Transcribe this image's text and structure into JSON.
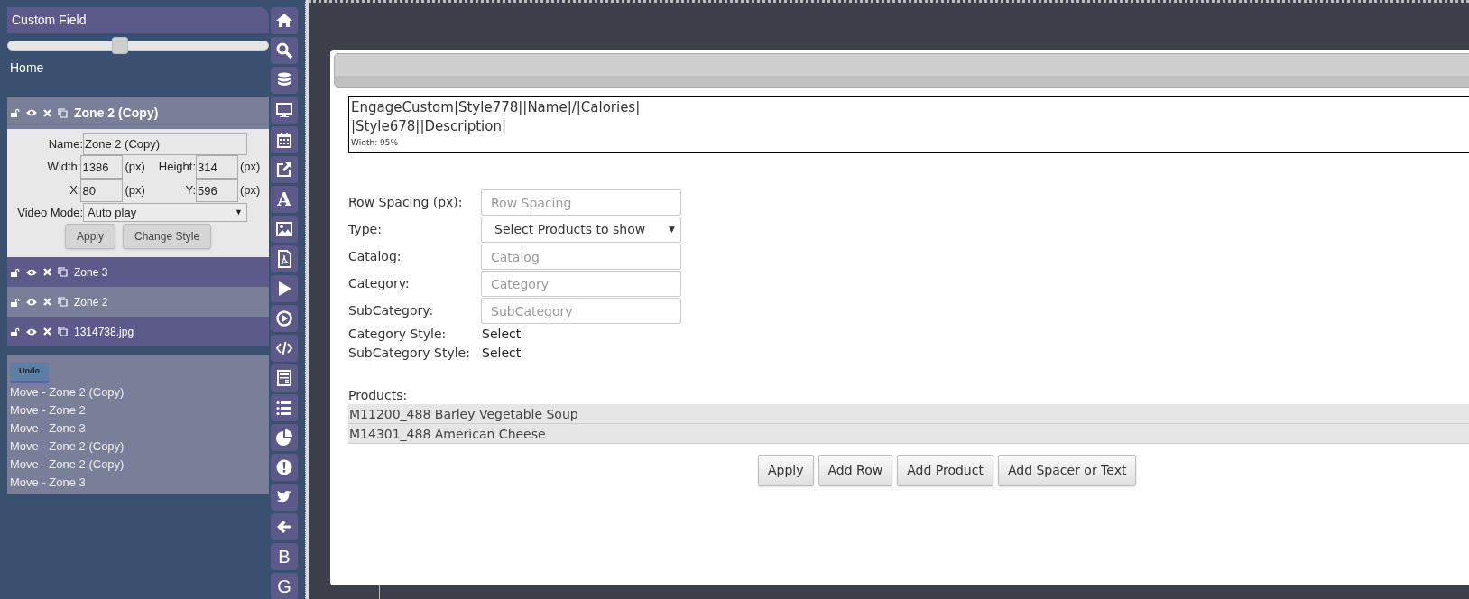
{
  "sidebar": {
    "header": "Custom Field",
    "slider": {
      "level": 0.43
    },
    "breadcrumb": "Home",
    "layers": [
      {
        "name": "Zone 2 (Copy)",
        "expanded": true,
        "highlighted": true
      },
      {
        "name": "Zone 3",
        "expanded": false,
        "highlighted": false
      },
      {
        "name": "Zone 2",
        "expanded": false,
        "highlighted": true
      },
      {
        "name": "1314738.jpg",
        "expanded": false,
        "highlighted": false
      }
    ],
    "zone_form": {
      "name": {
        "label": "Name:",
        "value": "Zone 2 (Copy)"
      },
      "pairs": [
        [
          {
            "label": "Width:",
            "value": "1386",
            "unit": "(px)"
          },
          {
            "label": "Height:",
            "value": "314",
            "unit": "(px)"
          }
        ],
        [
          {
            "label": "X:",
            "value": "80",
            "unit": "(px)"
          },
          {
            "label": "Y:",
            "value": "596",
            "unit": "(px)"
          }
        ]
      ],
      "video_mode": {
        "label": "Video Mode:",
        "value": "Auto play",
        "caret": "▼"
      },
      "buttons": [
        "Apply",
        "Change Style"
      ]
    },
    "history": {
      "undo_button": "Undo",
      "entries": [
        "Move - Zone 2 (Copy)",
        "Move - Zone 2",
        "Move - Zone 3",
        "Move - Zone 2 (Copy)",
        "Move - Zone 2 (Copy)",
        "Move - Zone 3"
      ]
    }
  },
  "toolbar": [
    {
      "kind": "icon"
    },
    {
      "kind": "icon"
    },
    {
      "kind": "icon"
    },
    {
      "kind": "icon"
    },
    {
      "kind": "icon"
    },
    {
      "kind": "icon"
    },
    {
      "kind": "letter",
      "text": "A"
    },
    {
      "kind": "icon"
    },
    {
      "kind": "icon"
    },
    {
      "kind": "icon"
    },
    {
      "kind": "icon"
    },
    {
      "kind": "icon"
    },
    {
      "kind": "icon"
    },
    {
      "kind": "icon"
    },
    {
      "kind": "icon"
    },
    {
      "kind": "icon"
    },
    {
      "kind": "icon"
    },
    {
      "kind": "icon"
    },
    {
      "kind": "letter",
      "text": "B"
    },
    {
      "kind": "letter",
      "text": "G"
    }
  ],
  "dialog": {
    "template": {
      "lines": [
        "EngageCustom|Style778||Name|/|Calories|",
        "|Style678||Description|"
      ],
      "width_note": "Width: 95%"
    },
    "fields": [
      {
        "kind": "input",
        "label": "Row Spacing (px):",
        "placeholder": "Row Spacing"
      },
      {
        "kind": "select",
        "label": "Type:",
        "value": "Select Products to show",
        "caret": "▼"
      },
      {
        "kind": "input",
        "label": "Catalog:",
        "placeholder": "Catalog"
      },
      {
        "kind": "input",
        "label": "Category:",
        "placeholder": "Category"
      },
      {
        "kind": "input",
        "label": "SubCategory:",
        "placeholder": "SubCategory"
      },
      {
        "kind": "text",
        "label": "Category Style:",
        "value": "Select"
      },
      {
        "kind": "text",
        "label": "SubCategory Style:",
        "value": "Select"
      }
    ],
    "products": {
      "label": "Products:",
      "rows": [
        "M11200_488 Barley Vegetable Soup",
        "M14301_488 American Cheese"
      ]
    },
    "buttons": [
      "Apply",
      "Add Row",
      "Add Product",
      "Add Spacer or Text"
    ]
  }
}
